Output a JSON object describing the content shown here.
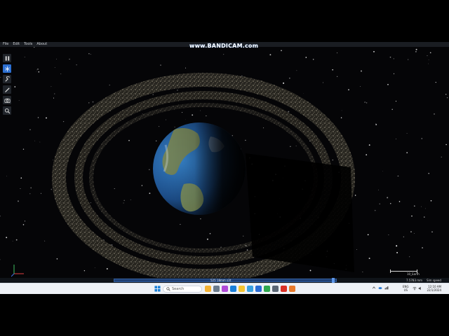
{
  "menu": {
    "items": [
      "File",
      "Edit",
      "Tools",
      "About"
    ]
  },
  "watermark": {
    "text": "www.BANDICAM.com"
  },
  "toolbar": {
    "tools": [
      {
        "icon": "pause-icon",
        "active": false
      },
      {
        "icon": "snowflake-icon",
        "active": true
      },
      {
        "icon": "wrench-icon",
        "active": false
      },
      {
        "icon": "pen-icon",
        "active": false
      },
      {
        "icon": "camera-icon",
        "active": false
      },
      {
        "icon": "search-icon",
        "active": false
      }
    ]
  },
  "viewport": {
    "scale_label": "10_Earth"
  },
  "statusbar": {
    "time": "525 18mm s3t",
    "distance": "7.5783 mm",
    "speed_label": "Sim speed"
  },
  "taskbar": {
    "search_placeholder": "Search",
    "language": [
      "ENG",
      "US"
    ],
    "clock": [
      "12:10 AM",
      "22/1/2024"
    ]
  },
  "colors": {
    "accent": "#2c6fd1",
    "space": "#050507",
    "earth_ocean": "#1f5a9c",
    "earth_land": "#7a8f4a"
  }
}
